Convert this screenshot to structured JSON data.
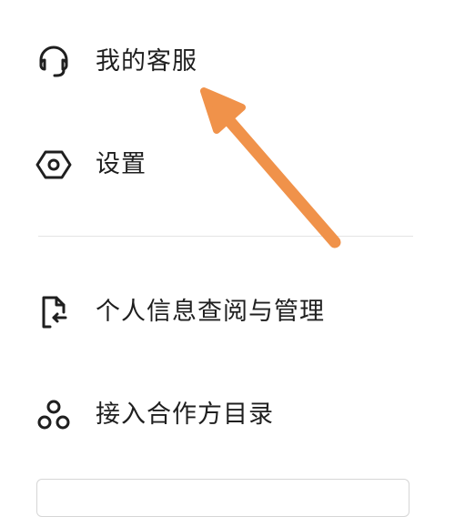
{
  "menu": {
    "items": [
      {
        "label": "我的客服",
        "icon": "headset-icon"
      },
      {
        "label": "设置",
        "icon": "hexagon-settings-icon"
      },
      {
        "label": "个人信息查阅与管理",
        "icon": "document-return-icon"
      },
      {
        "label": "接入合作方目录",
        "icon": "three-circles-icon"
      }
    ]
  },
  "annotation": {
    "arrow_color": "#f0924a",
    "points_to": "我的客服"
  },
  "colors": {
    "text": "#1f1f1f",
    "divider": "#e4e4e4",
    "arrow": "#f0924a"
  }
}
